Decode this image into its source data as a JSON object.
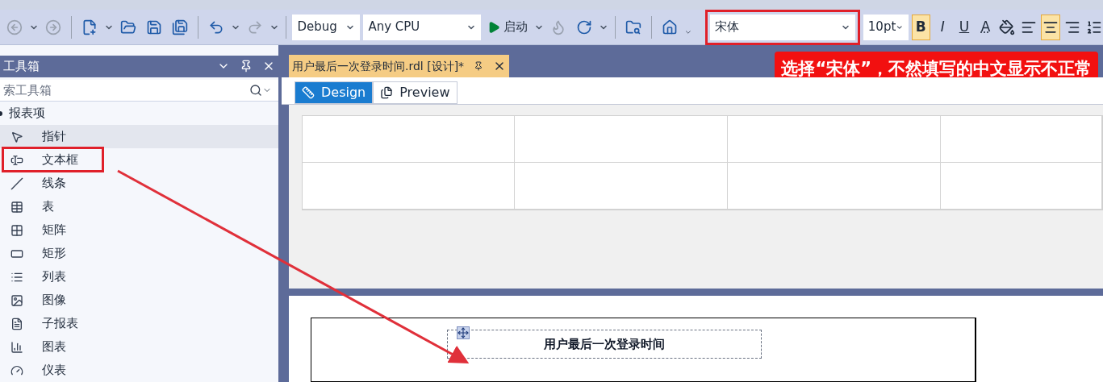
{
  "toolbar": {
    "items": [
      {
        "kind": "back",
        "disabled": true,
        "dropdown": true
      },
      {
        "kind": "forward",
        "disabled": true,
        "dropdown": false
      },
      {
        "kind": "separator"
      },
      {
        "kind": "new",
        "disabled": false,
        "dropdown": true
      },
      {
        "kind": "open",
        "disabled": false,
        "dropdown": false
      },
      {
        "kind": "save",
        "disabled": false,
        "dropdown": false
      },
      {
        "kind": "save_all",
        "disabled": false,
        "dropdown": false
      },
      {
        "kind": "separator"
      },
      {
        "kind": "undo",
        "disabled": false,
        "dropdown": true
      },
      {
        "kind": "redo",
        "disabled": true,
        "dropdown": true
      },
      {
        "kind": "separator"
      },
      {
        "kind": "config_combo",
        "value": "Debug",
        "highlighted": false
      },
      {
        "kind": "platform_combo",
        "value": "Any CPU",
        "highlighted": false
      },
      {
        "kind": "start",
        "label": "启动",
        "dropdown": true
      },
      {
        "kind": "flame",
        "disabled": true,
        "dropdown": false
      },
      {
        "kind": "refresh",
        "disabled": false,
        "dropdown": true
      },
      {
        "kind": "separator"
      },
      {
        "kind": "folder",
        "disabled": false,
        "dropdown": false
      },
      {
        "kind": "separator"
      },
      {
        "kind": "home",
        "disabled": false,
        "dropdown": false
      },
      {
        "kind": "overflow"
      },
      {
        "kind": "font_combo",
        "value": "宋体",
        "highlighted": true
      },
      {
        "kind": "size_combo",
        "value": "10pt",
        "highlighted": false
      },
      {
        "kind": "bold",
        "label": "B",
        "selected": true
      },
      {
        "kind": "italic",
        "label": "I",
        "selected": false
      },
      {
        "kind": "underline",
        "label": "U",
        "selected": false
      },
      {
        "kind": "font_color",
        "label": "A",
        "selected": false
      },
      {
        "kind": "fill",
        "selected": false
      },
      {
        "kind": "align_left",
        "selected": false
      },
      {
        "kind": "align_center",
        "selected": true
      },
      {
        "kind": "align_right",
        "selected": false
      },
      {
        "kind": "list",
        "selected": false
      }
    ]
  },
  "toolbox": {
    "title": "工具箱",
    "search": {
      "placeholder": "索工具箱"
    },
    "groups": [
      {
        "label": "报表项",
        "expanded": true,
        "children": [
          {
            "label": "指针",
            "kind": "pointer",
            "selected": true,
            "highlighted": false
          },
          {
            "label": "文本框",
            "kind": "textbox",
            "selected": false,
            "highlighted": true
          },
          {
            "label": "线条",
            "kind": "line",
            "selected": false,
            "highlighted": false
          },
          {
            "label": "表",
            "kind": "table",
            "selected": false,
            "highlighted": false
          },
          {
            "label": "矩阵",
            "kind": "matrix",
            "selected": false,
            "highlighted": false
          },
          {
            "label": "矩形",
            "kind": "rectangle",
            "selected": false,
            "highlighted": false
          },
          {
            "label": "列表",
            "kind": "list",
            "selected": false,
            "highlighted": false
          },
          {
            "label": "图像",
            "kind": "image",
            "selected": false,
            "highlighted": false
          },
          {
            "label": "子报表",
            "kind": "subreport",
            "selected": false,
            "highlighted": false
          },
          {
            "label": "图表",
            "kind": "chart",
            "selected": false,
            "highlighted": false
          },
          {
            "label": "仪表",
            "kind": "gauge",
            "selected": false,
            "highlighted": false
          }
        ]
      }
    ]
  },
  "document": {
    "tab": {
      "title": "用户最后一次登录时间.rdl [设计]*",
      "selected": true
    },
    "view_tabs": [
      {
        "label": "Design",
        "selected": true
      },
      {
        "label": "Preview",
        "selected": false
      }
    ],
    "callout": "选择“宋体”，不然填写的中文显示不正常",
    "report_textbox": "用户最后一次登录时间"
  }
}
